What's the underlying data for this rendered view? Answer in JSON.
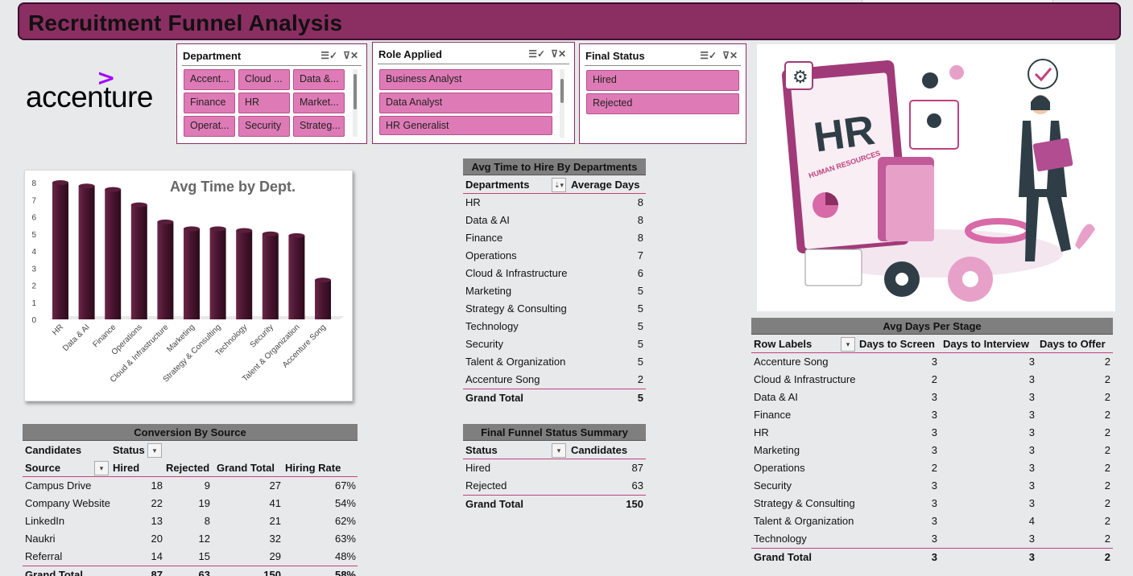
{
  "title": "Recruitment Funnel Analysis",
  "logo": {
    "text": "accenture",
    "mark": ">"
  },
  "slicers": {
    "department": {
      "title": "Department",
      "items": [
        "Accent...",
        "Cloud ...",
        "Data &...",
        "Finance",
        "HR",
        "Market...",
        "Operat...",
        "Security",
        "Strateg..."
      ]
    },
    "role": {
      "title": "Role Applied",
      "items": [
        "Business Analyst",
        "Data Analyst",
        "HR Generalist"
      ]
    },
    "status": {
      "title": "Final Status",
      "items": [
        "Hired",
        "Rejected"
      ]
    }
  },
  "chart_data": {
    "type": "bar",
    "title": "Avg Time by Dept.",
    "categories": [
      "HR",
      "Data & AI",
      "Finance",
      "Operations",
      "Cloud & Infrastructure",
      "Marketing",
      "Strategy & Consulting",
      "Technology",
      "Security",
      "Talent & Organization",
      "Accenture Song"
    ],
    "values": [
      8,
      7.8,
      7.6,
      6.7,
      5.7,
      5.3,
      5.3,
      5.2,
      5,
      4.9,
      2.3
    ],
    "ylim": [
      0,
      8
    ],
    "yticks": [
      "0",
      "1",
      "2",
      "3",
      "4",
      "5",
      "6",
      "7",
      "8"
    ],
    "bar_color": "#4a1530",
    "grid": false
  },
  "avg_time_dept": {
    "title": "Avg Time to Hire By Departments",
    "col1": "Departments",
    "col2": "Average Days",
    "rows": [
      [
        "HR",
        "8"
      ],
      [
        "Data & AI",
        "8"
      ],
      [
        "Finance",
        "8"
      ],
      [
        "Operations",
        "7"
      ],
      [
        "Cloud & Infrastructure",
        "6"
      ],
      [
        "Marketing",
        "5"
      ],
      [
        "Strategy & Consulting",
        "5"
      ],
      [
        "Technology",
        "5"
      ],
      [
        "Security",
        "5"
      ],
      [
        "Talent & Organization",
        "5"
      ],
      [
        "Accenture Song",
        "2"
      ]
    ],
    "total_label": "Grand Total",
    "total_value": "5"
  },
  "funnel_status": {
    "title": "Final Funnel Status Summary",
    "col1": "Status",
    "col2": "Candidates",
    "rows": [
      [
        "Hired",
        "87"
      ],
      [
        "Rejected",
        "63"
      ]
    ],
    "total_label": "Grand Total",
    "total_value": "150"
  },
  "conversion": {
    "title": "Conversion By Source",
    "label_candidates": "Candidates",
    "label_status": "Status",
    "cols": [
      "Source",
      "Hired",
      "Rejected",
      "Grand Total",
      "Hiring Rate"
    ],
    "rows": [
      [
        "Campus Drive",
        "18",
        "9",
        "27",
        "67%"
      ],
      [
        "Company Website",
        "22",
        "19",
        "41",
        "54%"
      ],
      [
        "LinkedIn",
        "13",
        "8",
        "21",
        "62%"
      ],
      [
        "Naukri",
        "20",
        "12",
        "32",
        "63%"
      ],
      [
        "Referral",
        "14",
        "15",
        "29",
        "48%"
      ]
    ],
    "total": [
      "Grand Total",
      "87",
      "63",
      "150",
      "58%"
    ]
  },
  "stage": {
    "title": "Avg Days Per Stage",
    "cols": [
      "Row Labels",
      "Days to Screen",
      "Days to Interview",
      "Days to Offer"
    ],
    "rows": [
      [
        "Accenture Song",
        "3",
        "3",
        "2"
      ],
      [
        "Cloud & Infrastructure",
        "2",
        "3",
        "2"
      ],
      [
        "Data & AI",
        "3",
        "3",
        "2"
      ],
      [
        "Finance",
        "3",
        "3",
        "2"
      ],
      [
        "HR",
        "3",
        "3",
        "2"
      ],
      [
        "Marketing",
        "3",
        "3",
        "2"
      ],
      [
        "Operations",
        "2",
        "3",
        "2"
      ],
      [
        "Security",
        "3",
        "3",
        "2"
      ],
      [
        "Strategy & Consulting",
        "3",
        "3",
        "2"
      ],
      [
        "Talent & Organization",
        "3",
        "4",
        "2"
      ],
      [
        "Technology",
        "3",
        "3",
        "2"
      ]
    ],
    "total": [
      "Grand Total",
      "3",
      "3",
      "2"
    ]
  },
  "illustration": {
    "hr": "HR",
    "sub": "HUMAN RESOURCES"
  },
  "colors": {
    "accent": "#8b2e62",
    "chip": "#de7bb6",
    "bar": "#4a1530",
    "header_gray": "#7f7f7f"
  },
  "icons": [
    "multi-select-icon",
    "clear-filter-icon",
    "dropdown-icon",
    "filter-dropdown-icon"
  ]
}
